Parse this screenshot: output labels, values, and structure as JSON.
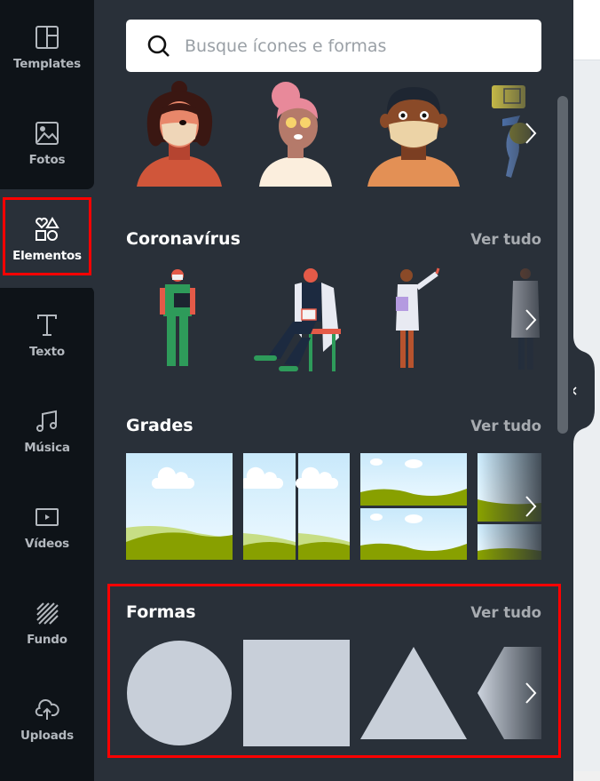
{
  "sidebar": {
    "items": [
      {
        "label": "Templates",
        "icon": "templates-layout-icon",
        "active": false
      },
      {
        "label": "Fotos",
        "icon": "photo-icon",
        "active": false
      },
      {
        "label": "Elementos",
        "icon": "shapes-icon",
        "active": true
      },
      {
        "label": "Texto",
        "icon": "text-icon",
        "active": false
      },
      {
        "label": "Música",
        "icon": "music-note-icon",
        "active": false
      },
      {
        "label": "Vídeos",
        "icon": "video-play-icon",
        "active": false
      },
      {
        "label": "Fundo",
        "icon": "background-stripes-icon",
        "active": false
      },
      {
        "label": "Uploads",
        "icon": "cloud-upload-icon",
        "active": false
      }
    ]
  },
  "search": {
    "placeholder": "Busque ícones e formas",
    "value": ""
  },
  "sections": [
    {
      "title": "",
      "items": [
        "woman-with-bun-mask",
        "woman-pink-hair-sunglasses",
        "man-with-mask",
        "person-with-monitor"
      ]
    },
    {
      "title": "Coronavírus",
      "see_all": "Ver tudo",
      "items": [
        "nurse-green-scrubs",
        "doctor-seated-clipboard",
        "doctor-woman-pointing",
        "doctor-arms-crossed"
      ]
    },
    {
      "title": "Grades",
      "see_all": "Ver tudo",
      "items": [
        "grid-single",
        "grid-two-columns",
        "grid-two-rows",
        "grid-mixed"
      ]
    },
    {
      "title": "Formas",
      "see_all": "Ver tudo",
      "items": [
        "circle",
        "square",
        "triangle",
        "hexagon"
      ]
    }
  ],
  "colors": {
    "panel_bg": "#293039",
    "sidebar_bg": "#0e1318",
    "shape_fill": "#c8cfd9",
    "highlight": "#ff0000"
  }
}
